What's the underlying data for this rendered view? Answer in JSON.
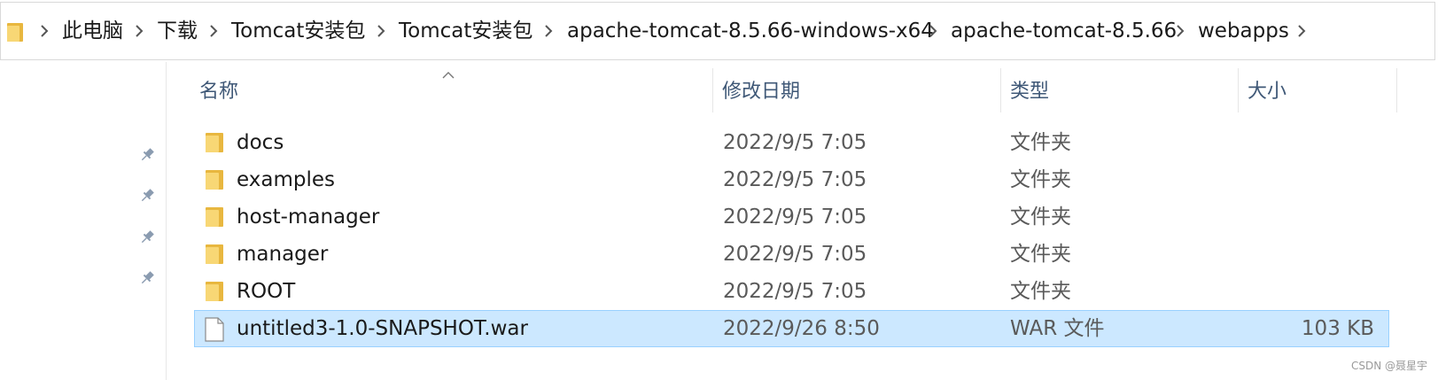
{
  "breadcrumb": {
    "root_icon": "folder-icon",
    "items": [
      "此电脑",
      "下载",
      "Tomcat安装包",
      "Tomcat安装包",
      "apache-tomcat-8.5.66-windows-x64",
      "apache-tomcat-8.5.66",
      "webapps"
    ],
    "separator_icon": "chevron-right-icon"
  },
  "columns": {
    "name": "名称",
    "date": "修改日期",
    "type": "类型",
    "size": "大小",
    "sort_indicator": "sort-ascending-caret-icon"
  },
  "sidebar": {
    "pins": [
      "pin-icon",
      "pin-icon",
      "pin-icon",
      "pin-icon"
    ]
  },
  "files": [
    {
      "name": "docs",
      "date": "2022/9/5 7:05",
      "type": "文件夹",
      "size": "",
      "icon": "folder-icon",
      "selected": false
    },
    {
      "name": "examples",
      "date": "2022/9/5 7:05",
      "type": "文件夹",
      "size": "",
      "icon": "folder-icon",
      "selected": false
    },
    {
      "name": "host-manager",
      "date": "2022/9/5 7:05",
      "type": "文件夹",
      "size": "",
      "icon": "folder-icon",
      "selected": false
    },
    {
      "name": "manager",
      "date": "2022/9/5 7:05",
      "type": "文件夹",
      "size": "",
      "icon": "folder-icon",
      "selected": false
    },
    {
      "name": "ROOT",
      "date": "2022/9/5 7:05",
      "type": "文件夹",
      "size": "",
      "icon": "folder-icon",
      "selected": false
    },
    {
      "name": "untitled3-1.0-SNAPSHOT.war",
      "date": "2022/9/26 8:50",
      "type": "WAR 文件",
      "size": "103 KB",
      "icon": "file-icon",
      "selected": true
    }
  ],
  "watermark": "CSDN @聂星宇",
  "colors": {
    "selection_fill": "#cce8ff",
    "selection_border": "#99d1ff",
    "header_text": "#3f5877",
    "folder_yellow": "#f8d775"
  }
}
